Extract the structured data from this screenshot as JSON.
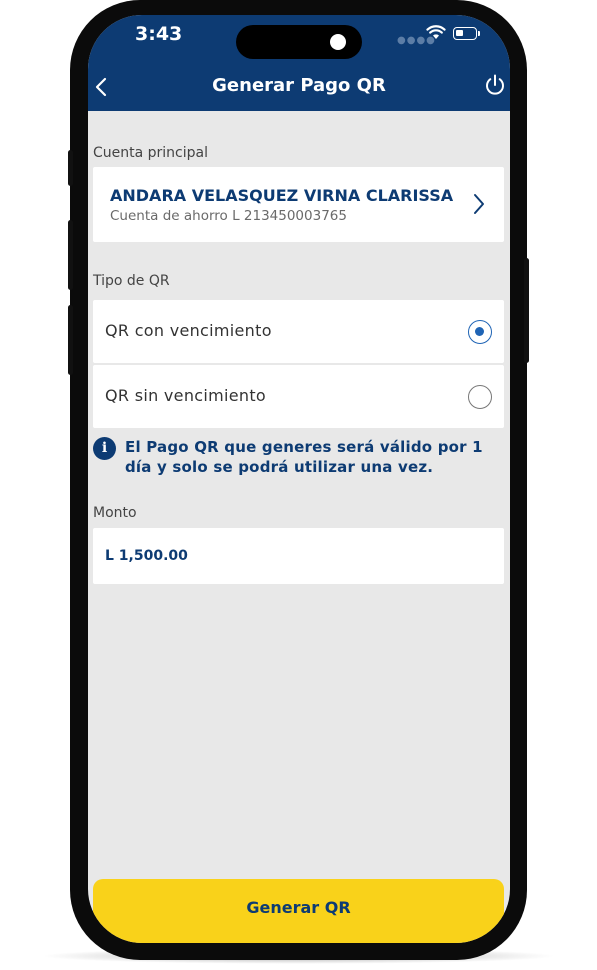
{
  "status_bar": {
    "time": "3:43"
  },
  "header": {
    "title": "Generar Pago QR",
    "back_icon": "chevron-left-icon",
    "power_icon": "power-icon"
  },
  "account": {
    "section_label": "Cuenta principal",
    "name": "ANDARA VELASQUEZ VIRNA CLARISSA",
    "detail": "Cuenta de ahorro L 213450003765"
  },
  "qr_type": {
    "section_label": "Tipo de QR",
    "options": [
      {
        "label": "QR con vencimiento",
        "selected": true
      },
      {
        "label": "QR sin vencimiento",
        "selected": false
      }
    ],
    "info_icon_glyph": "i",
    "info": "El Pago QR que generes será válido por 1 día y solo se podrá utilizar una vez."
  },
  "amount": {
    "section_label": "Monto",
    "value": "L 1,500.00"
  },
  "submit": {
    "label": "Generar QR"
  },
  "colors": {
    "primary": "#0d3b73",
    "accent": "#f9d21a",
    "background": "#e8e8e8",
    "radio": "#1f64b5"
  }
}
